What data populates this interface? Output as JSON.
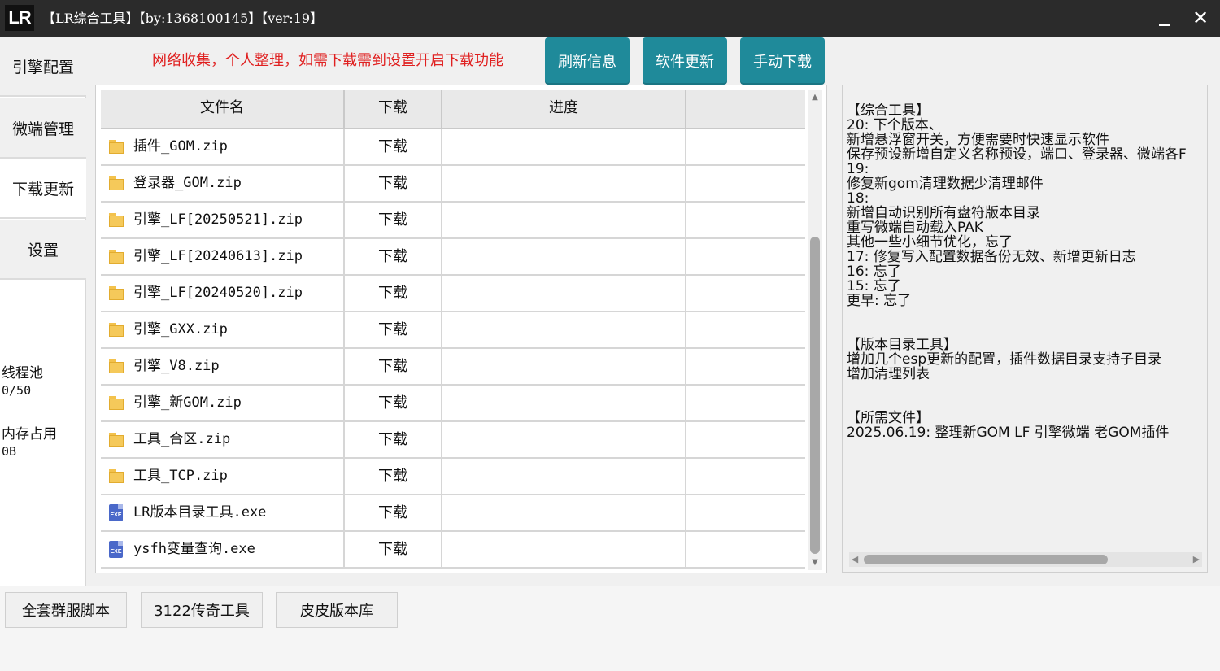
{
  "window": {
    "logo": "LR",
    "title": "【LR综合工具】【by:1368100145】【ver:19】",
    "minimize_label": "",
    "close_label": "✕"
  },
  "sidebar": {
    "items": [
      {
        "label": "引擎配置"
      },
      {
        "label": "微端管理"
      },
      {
        "label": "下载更新"
      },
      {
        "label": "设置"
      }
    ],
    "active_index": 2,
    "thread_pool_label": "线程池",
    "thread_pool_value": "0/50",
    "memory_label": "内存占用",
    "memory_value": "0B"
  },
  "toolbar": {
    "notice": "网络收集，个人整理，如需下载需到设置开启下载功能",
    "refresh_label": "刷新信息",
    "update_label": "软件更新",
    "manual_download_label": "手动下载",
    "accent_color": "#1f8a9a",
    "notice_color": "#e02020"
  },
  "table": {
    "columns": [
      "文件名",
      "下载",
      "进度",
      ""
    ],
    "rows": [
      {
        "icon": "folder-icon",
        "name": "插件_GOM.zip",
        "download": "下载",
        "progress": ""
      },
      {
        "icon": "folder-icon",
        "name": "登录器_GOM.zip",
        "download": "下载",
        "progress": ""
      },
      {
        "icon": "folder-icon",
        "name": "引擎_LF[20250521].zip",
        "download": "下载",
        "progress": ""
      },
      {
        "icon": "folder-icon",
        "name": "引擎_LF[20240613].zip",
        "download": "下载",
        "progress": ""
      },
      {
        "icon": "folder-icon",
        "name": "引擎_LF[20240520].zip",
        "download": "下载",
        "progress": ""
      },
      {
        "icon": "folder-icon",
        "name": "引擎_GXX.zip",
        "download": "下载",
        "progress": ""
      },
      {
        "icon": "folder-icon",
        "name": "引擎_V8.zip",
        "download": "下载",
        "progress": ""
      },
      {
        "icon": "folder-icon",
        "name": "引擎_新GOM.zip",
        "download": "下载",
        "progress": ""
      },
      {
        "icon": "folder-icon",
        "name": "工具_合区.zip",
        "download": "下载",
        "progress": ""
      },
      {
        "icon": "folder-icon",
        "name": "工具_TCP.zip",
        "download": "下载",
        "progress": ""
      },
      {
        "icon": "exe-icon",
        "name": "LR版本目录工具.exe",
        "download": "下载",
        "progress": ""
      },
      {
        "icon": "exe-icon",
        "name": "ysfh变量查询.exe",
        "download": "下载",
        "progress": ""
      }
    ]
  },
  "changelog": {
    "lines": [
      "【综合工具】",
      "20: 下个版本、",
      "新增悬浮窗开关，方便需要时快速显示软件",
      "保存预设新增自定义名称预设，端口、登录器、微端各F",
      "19:",
      "修复新gom清理数据少清理邮件",
      "18:",
      "新增自动识别所有盘符版本目录",
      "重写微端自动载入PAK",
      "其他一些小细节优化，忘了",
      "17: 修复写入配置数据备份无效、新增更新日志",
      "16: 忘了",
      "15: 忘了",
      "更早: 忘了",
      "",
      "【版本目录工具】",
      "增加几个esp更新的配置，插件数据目录支持子目录",
      "增加清理列表",
      "",
      "【所需文件】",
      "2025.06.19: 整理新GOM LF 引擎微端 老GOM插件"
    ]
  },
  "bottom": {
    "buttons": [
      {
        "label": "全套群服脚本"
      },
      {
        "label": "3122传奇工具"
      },
      {
        "label": "皮皮版本库"
      }
    ]
  }
}
